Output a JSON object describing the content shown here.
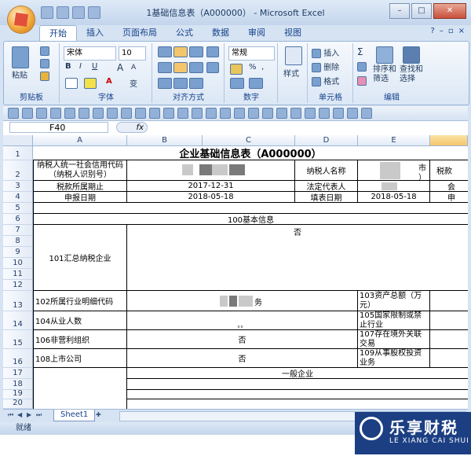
{
  "window": {
    "title": "1基础信息表（A000000） - Microsoft Excel",
    "minimize": "–",
    "maximize": "□",
    "close": "✕"
  },
  "ribbon": {
    "tabs": [
      "开始",
      "插入",
      "页面布局",
      "公式",
      "数据",
      "审阅",
      "视图"
    ],
    "help": "?",
    "paste_label": "粘贴",
    "font_name": "宋体",
    "font_size": "10",
    "bold": "B",
    "italic": "I",
    "underline": "U",
    "grow": "A",
    "shrink": "A",
    "font_color": "A",
    "phonetic": "变",
    "number_format": "常规",
    "percent": "%",
    "comma": ",",
    "style_label": "样式",
    "insert_label": "插入",
    "delete_label": "删除",
    "format_label": "格式",
    "sum": "Σ",
    "sort_label": "排序和\n筛选",
    "find_label": "查找和\n选择",
    "groups": [
      "剪贴板",
      "字体",
      "对齐方式",
      "数字",
      "单元格",
      "编辑"
    ]
  },
  "formula": {
    "namebox": "F40",
    "fx": "fx",
    "content": ""
  },
  "columns": [
    "A",
    "B",
    "C",
    "D",
    "E",
    ""
  ],
  "rows": [
    "1",
    "2",
    "3",
    "4",
    "5",
    "6",
    "7",
    "8",
    "9",
    "10",
    "11",
    "12",
    "13",
    "14",
    "15",
    "16",
    "17",
    "18",
    "19",
    "20"
  ],
  "cells": {
    "title": "企业基础信息表（A000000）",
    "r2a1": "纳税人统一社会信用代码",
    "r2a2": "（纳税人识别号）",
    "r2d": "纳税人名称",
    "r2e": "市",
    "r2e2": "）",
    "r2f": "税款",
    "r3a": "税款所属期止",
    "r3bc": "2017-12-31",
    "r3d": "法定代表人",
    "r3f": "会",
    "r4a": "申报日期",
    "r4bc": "2018-05-18",
    "r4d": "填表日期",
    "r4e": "2018-05-18",
    "r4f": "申",
    "r6": "100基本信息",
    "r7": "否",
    "r101": "101汇总纳税企业",
    "r102": "102所属行业明细代码",
    "r102v": "务",
    "r103": "103资产总额（万元）",
    "r104": "104从业人数",
    "r104v": "。。",
    "r105": "105国家限制或禁止行业",
    "r106": "106非营利组织",
    "r106v": "否",
    "r107": "107存在境外关联交易",
    "r108": "108上市公司",
    "r108v": "否",
    "r109": "109从事股权投资业务",
    "r17": "一般企业"
  },
  "sheet": {
    "tab": "Sheet1"
  },
  "status": {
    "ready": "就绪"
  },
  "logo": {
    "cn": "乐享财税",
    "en": "LE XIANG CAI SHUI"
  }
}
